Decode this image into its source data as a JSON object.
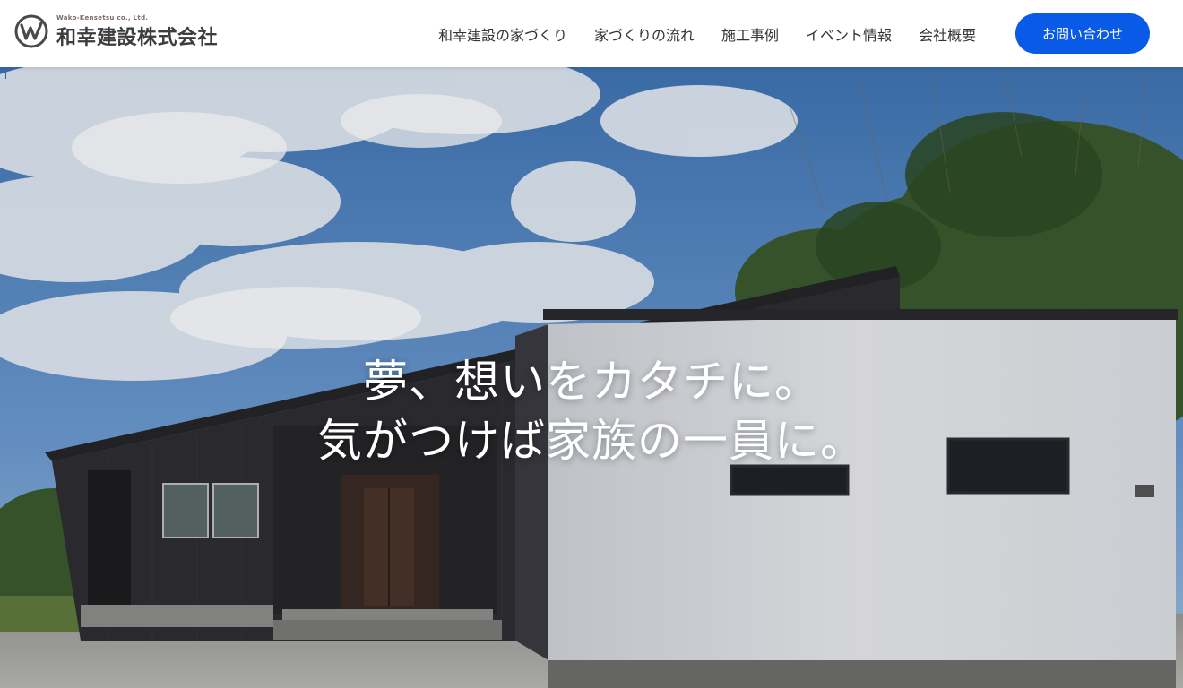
{
  "header": {
    "logo": {
      "en_text": "Wako-Kensetsu co., Ltd.",
      "ja_text": "和幸建設株式会社"
    },
    "nav": [
      {
        "label": "和幸建設の家づくり"
      },
      {
        "label": "家づくりの流れ"
      },
      {
        "label": "施工事例"
      },
      {
        "label": "イベント情報"
      },
      {
        "label": "会社概要"
      }
    ],
    "contact_button": {
      "label": "お問い合わせ"
    }
  },
  "hero": {
    "tagline_line1": "夢、想いをカタチに。",
    "tagline_line2": "気がつけば家族の一員に。"
  },
  "colors": {
    "accent": "#0a5ae8",
    "nav_text": "#333333",
    "sky": "#5f8ec4",
    "house_dark": "#2b2b30",
    "house_white": "#e4e6ea"
  }
}
